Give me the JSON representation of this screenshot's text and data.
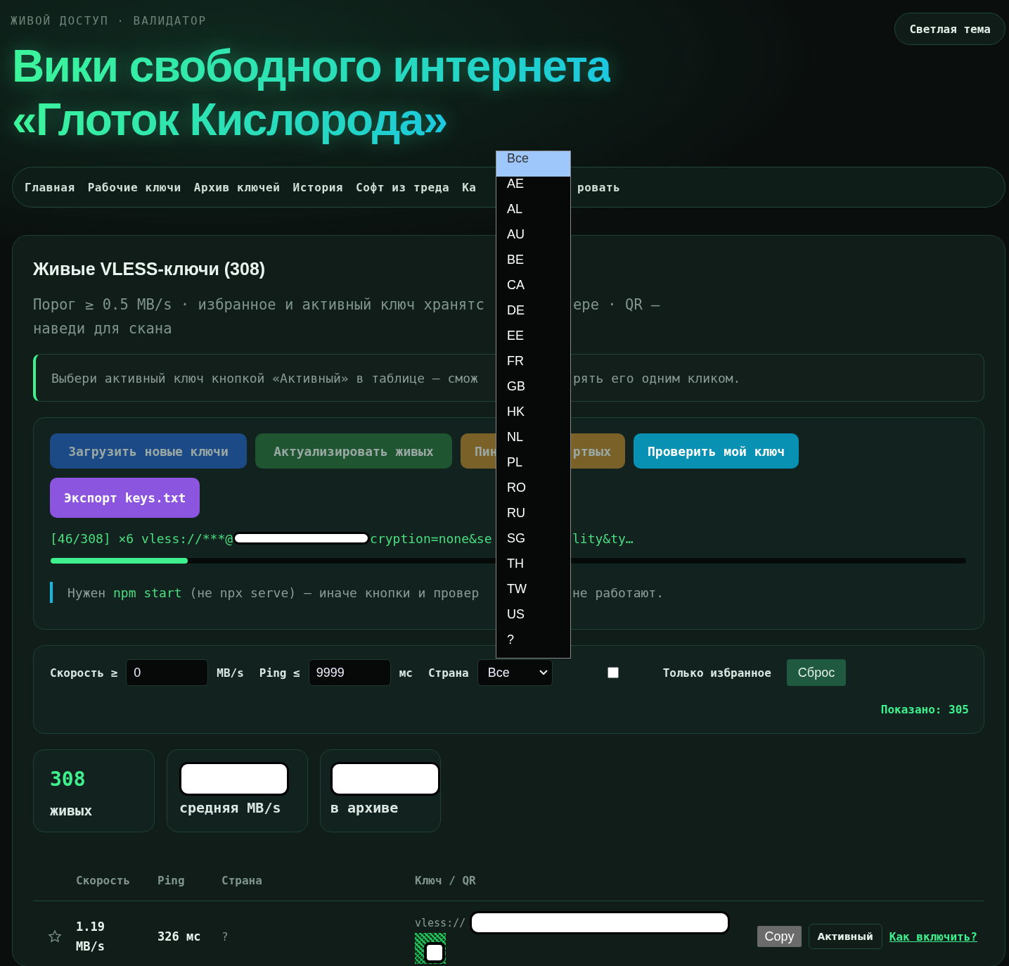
{
  "header": {
    "eyebrow": "ЖИВОЙ ДОСТУП · ВАЛИДАТОР",
    "title_lines": [
      "Вики свободного интернета",
      "«Глоток Кислорода»"
    ],
    "theme_button": "Светлая тема"
  },
  "nav": {
    "items_before": [
      "Главная",
      "Рабочие ключи",
      "Архив ключей",
      "История",
      "Софт из треда",
      "Ка"
    ],
    "items_after": [
      "ровать"
    ]
  },
  "panel": {
    "title": "Живые VLESS-ключи (308)",
    "subtitle": {
      "start": "Порог ≥ 0.5 MB/s · избранное и активный ключ хранятс",
      "end": "ере · QR –",
      "line2": "наведи для скана"
    },
    "info": {
      "start": "Выбери активный ключ кнопкой «Активный» в таблице – смож",
      "end": "рять его одним кликом."
    },
    "actions": {
      "button_rows": [
        [
          {
            "parts": [
              "Загрузить новые ключи"
            ],
            "color": "#1c4a86",
            "disabled": true
          },
          {
            "parts": [
              "Актуализировать живых"
            ],
            "color": "#1f5530",
            "disabled": true
          },
          {
            "parts": [
              "Пин",
              "ртвых"
            ],
            "color": "#7a6128",
            "disabled": true
          },
          {
            "parts": [
              "Проверить мой ключ"
            ],
            "color": "#0891b2",
            "disabled": false
          }
        ],
        [
          {
            "parts": [
              "Экспорт keys.txt"
            ],
            "color": "#8b55e0",
            "disabled": false
          }
        ]
      ],
      "progress": {
        "parts": [
          "[46/308] ×6 vless://***@",
          "cryption=none&se"
        ],
        "end": "lity&ty…",
        "level": 0.15
      },
      "note": {
        "start": "Нужен ",
        "code": "npm start",
        "rest": " (не npx serve) – иначе кнопки и провер",
        "end": "не работают."
      }
    },
    "filters": {
      "speed_label": "Скорость ≥",
      "speed_value": "0",
      "speed_unit": "MB/s",
      "ping_label": "Ping ≤",
      "ping_value": "9999",
      "ping_unit": "мс",
      "country_label": "Страна",
      "country_value": "Все",
      "favorites_only": {
        "label": "Только избранное",
        "checked": false
      },
      "reset": "Сброс",
      "shown": "Показано: 305"
    },
    "stats": [
      {
        "value": "308",
        "redacted": false,
        "label": "живых"
      },
      {
        "redacted": true,
        "label": "средняя MB/s"
      },
      {
        "redacted": true,
        "label": "в архиве"
      }
    ],
    "table": {
      "columns": [
        "Скорость",
        "Ping",
        "Страна",
        "Ключ / QR"
      ],
      "rows": [
        {
          "favorite": false,
          "speed": "1.19 MB/s",
          "ping": "326 мс",
          "country": "?",
          "key": "vless://",
          "copy": "Copy",
          "active": {
            "label": "Активный",
            "selected": false
          },
          "link": "Как включить?"
        }
      ]
    }
  },
  "dropdown": {
    "options": [
      {
        "label": "Все",
        "selected": true
      },
      {
        "label": "AE",
        "selected": false
      },
      {
        "label": "AL",
        "selected": false
      },
      {
        "label": "AU",
        "selected": false
      },
      {
        "label": "BE",
        "selected": false
      },
      {
        "label": "CA",
        "selected": false
      },
      {
        "label": "DE",
        "selected": false
      },
      {
        "label": "EE",
        "selected": false
      },
      {
        "label": "FR",
        "selected": false
      },
      {
        "label": "GB",
        "selected": false
      },
      {
        "label": "HK",
        "selected": false
      },
      {
        "label": "NL",
        "selected": false
      },
      {
        "label": "PL",
        "selected": false
      },
      {
        "label": "RO",
        "selected": false
      },
      {
        "label": "RU",
        "selected": false
      },
      {
        "label": "SG",
        "selected": false
      },
      {
        "label": "TH",
        "selected": false
      },
      {
        "label": "TW",
        "selected": false
      },
      {
        "label": "US",
        "selected": false
      },
      {
        "label": "?",
        "selected": false
      }
    ]
  }
}
